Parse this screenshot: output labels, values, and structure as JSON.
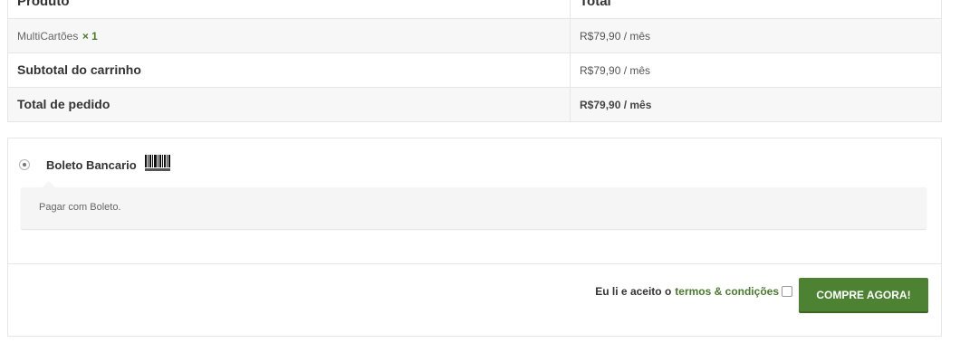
{
  "order_table": {
    "headers": {
      "product": "Produto",
      "total": "Total"
    },
    "item": {
      "name": "MultiCartões",
      "qty": "× 1",
      "amount": "R$79,90",
      "period": " / mês"
    },
    "subtotal": {
      "label": "Subtotal do carrinho",
      "amount": "R$79,90",
      "period": " / mês"
    },
    "total": {
      "label": "Total de pedido",
      "amount": "R$79,90",
      "period": " / mês"
    }
  },
  "payment": {
    "method_label": "Boleto Bancario",
    "barcode_icon": "barcode-icon",
    "description": "Pagar com Boleto.",
    "terms_prefix": "Eu li e aceito o",
    "terms_link": "termos & condições",
    "buy_label": "COMPRE AGORA!",
    "accent_color": "#4c8232"
  }
}
